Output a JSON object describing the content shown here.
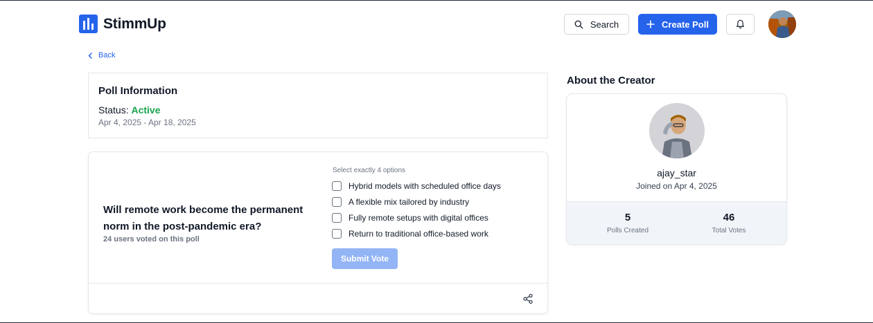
{
  "header": {
    "brand": "StimmUp",
    "search_label": "Search",
    "create_label": "Create Poll"
  },
  "nav": {
    "back_label": "Back"
  },
  "poll_info": {
    "title": "Poll Information",
    "status_label": "Status:",
    "status_value": "Active",
    "status_color": "#16a34a",
    "date_range": "Apr 4, 2025 - Apr 18, 2025"
  },
  "poll": {
    "question": "Will remote work become the permanent norm in the post-pandemic era?",
    "voters": "24 users voted on this poll",
    "instruction": "Select exactly 4 options",
    "options": [
      {
        "label": "Hybrid models with scheduled office days",
        "checked": false
      },
      {
        "label": "A flexible mix tailored by industry",
        "checked": false
      },
      {
        "label": "Fully remote setups with digital offices",
        "checked": false
      },
      {
        "label": "Return to traditional office-based work",
        "checked": false
      }
    ],
    "submit_label": "Submit Vote"
  },
  "creator": {
    "section_title": "About the Creator",
    "username": "ajay_star",
    "joined": "Joined on Apr 4, 2025",
    "stats": [
      {
        "value": "5",
        "label": "Polls Created"
      },
      {
        "value": "46",
        "label": "Total Votes"
      }
    ]
  },
  "colors": {
    "accent": "#2563eb",
    "submit_disabled": "#93b4f5"
  }
}
